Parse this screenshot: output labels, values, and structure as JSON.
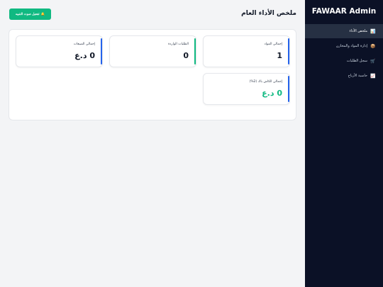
{
  "app": {
    "brand": "FAWAAR Admin"
  },
  "sidebar": {
    "items": [
      {
        "icon": "📊",
        "label": "ملخص الأداء",
        "active": true
      },
      {
        "icon": "📦",
        "label": "إدارة المواد والمخازن",
        "active": false
      },
      {
        "icon": "🛒",
        "label": "سجل الطلبات",
        "active": false
      },
      {
        "icon": "📈",
        "label": "حاسبة الأرباح",
        "active": false
      }
    ]
  },
  "header": {
    "title": "ملخص الأداء العام",
    "notify_button": {
      "icon": "🔔",
      "label": "تفعيل صوت التنبيه"
    }
  },
  "stats": [
    {
      "label": "إجمالي المواد",
      "value": "1",
      "accent": "#2563eb"
    },
    {
      "label": "الطلبات الواردة",
      "value": "0",
      "accent": "#10b981"
    },
    {
      "label": "إجمالي المبيعات",
      "value": "0 د.ع",
      "accent": "#2563eb"
    },
    {
      "label": "إجمالي الكاش باك (2%)",
      "value": "0 د.ع",
      "accent": "#2563eb",
      "value_color": "#10b981"
    }
  ],
  "colors": {
    "sidebar_bg": "#0b1126",
    "sidebar_active": "#263043",
    "button_green": "#10b981"
  }
}
